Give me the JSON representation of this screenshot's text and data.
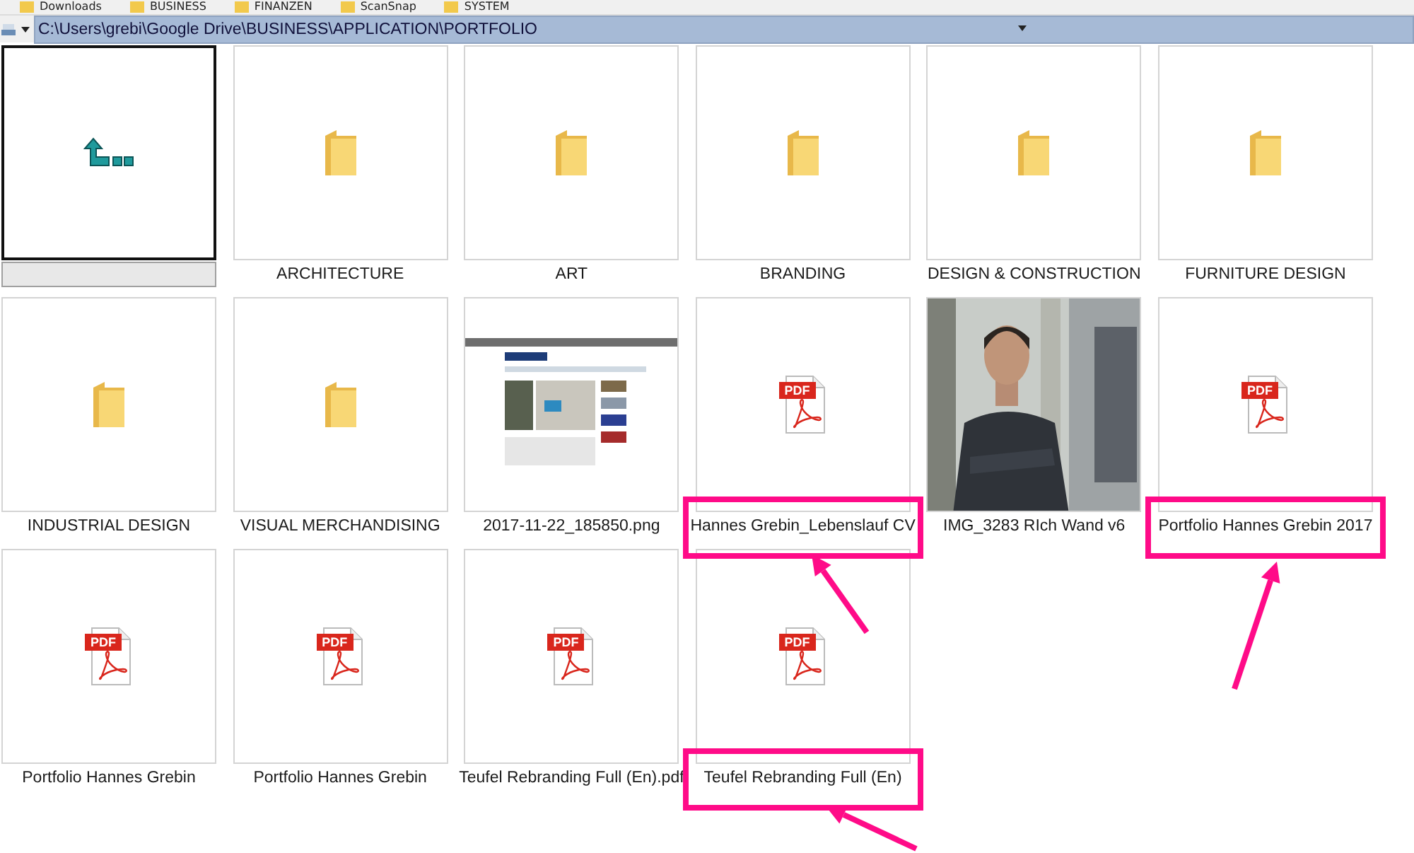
{
  "bookmarks": [
    "Downloads",
    "BUSINESS",
    "FINANZEN",
    "ScanSnap",
    "SYSTEM"
  ],
  "path_bar": {
    "value": "C:\\Users\\grebi\\Google Drive\\BUSINESS\\APPLICATION\\PORTFOLIO"
  },
  "items": [
    {
      "kind": "up",
      "selected": true
    },
    {
      "kind": "folder",
      "label": "ARCHITECTURE",
      "selected": false
    },
    {
      "kind": "folder",
      "label": "ART",
      "selected": false
    },
    {
      "kind": "folder",
      "label": "BRANDING",
      "selected": false
    },
    {
      "kind": "folder",
      "label": "DESIGN & CONSTRUCTION",
      "selected": false
    },
    {
      "kind": "folder",
      "label": "FURNITURE DESIGN",
      "selected": false
    },
    {
      "kind": "folder",
      "label": "INDUSTRIAL DESIGN",
      "selected": false
    },
    {
      "kind": "folder",
      "label": "VISUAL MERCHANDISING",
      "selected": false
    },
    {
      "kind": "screenshot",
      "label": "2017-11-22_185850.png",
      "selected": false
    },
    {
      "kind": "pdf",
      "label": "Hannes Grebin_Lebenslauf CV",
      "icon_label": "PDF",
      "selected": false,
      "highlighted": true
    },
    {
      "label": "IMG_3283 RIch Wand v6",
      "selected": false
    },
    {
      "kind": "pdf",
      "label": "Portfolio Hannes Grebin 2017",
      "icon_label": "PDF",
      "selected": false,
      "highlighted": true
    },
    {
      "kind": "pdf",
      "label": "Portfolio Hannes Grebin",
      "icon_label": "PDF",
      "selected": false
    },
    {
      "kind": "pdf",
      "label": "Portfolio Hannes Grebin",
      "icon_label": "PDF",
      "selected": false
    },
    {
      "kind": "pdf",
      "label": "Teufel Rebranding Full (En).pdf",
      "icon_label": "PDF",
      "selected": false
    },
    {
      "kind": "pdf",
      "label": "Teufel Rebranding Full (En)",
      "icon_label": "PDF",
      "selected": false,
      "highlighted": true
    }
  ]
}
